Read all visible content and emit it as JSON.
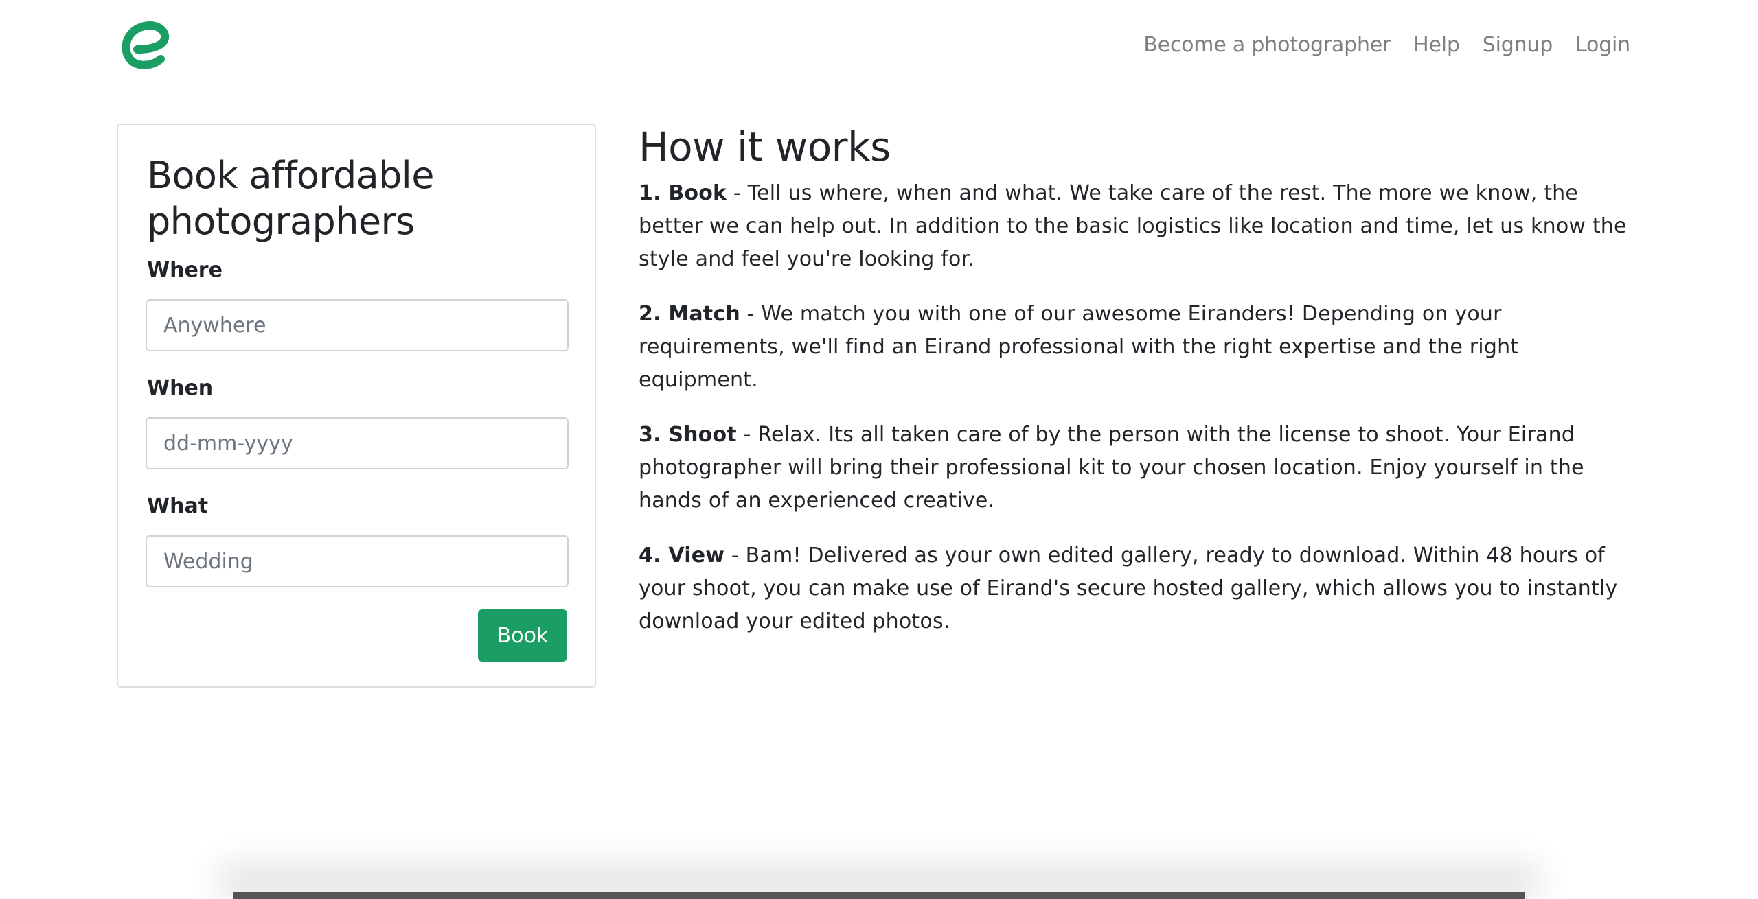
{
  "nav": {
    "logo_icon": "eirand-logo-icon",
    "brand_color": "#1a9e64",
    "links": {
      "become_photographer": "Become a photographer",
      "help": "Help",
      "signup": "Signup",
      "login": "Login"
    }
  },
  "booking": {
    "title": "Book affordable photographers",
    "where_label": "Where",
    "where_placeholder": "Anywhere",
    "when_label": "When",
    "when_placeholder": "dd-mm-yyyy",
    "what_label": "What",
    "what_placeholder": "Wedding",
    "book_label": "Book",
    "button_color": "#1a9e64"
  },
  "how_it_works": {
    "title": "How it works",
    "steps": [
      {
        "name": "1. Book",
        "text": " - Tell us where, when and what. We take care of the rest. The more we know, the better we can help out. In addition to the basic logistics like location and time, let us know the style and feel you're looking for."
      },
      {
        "name": "2. Match",
        "text": " - We match you with one of our awesome Eiranders! Depending on your requirements, we'll find an Eirand professional with the right expertise and the right equipment."
      },
      {
        "name": "3. Shoot",
        "text": " - Relax. Its all taken care of by the person with the license to shoot. Your Eirand photographer will bring their professional kit to your chosen location. Enjoy yourself in the hands of an experienced creative."
      },
      {
        "name": "4. View",
        "text": " - Bam! Delivered as your own edited gallery, ready to download. Within 48 hours of your shoot, you can make use of Eirand's secure hosted gallery, which allows you to instantly download your edited photos."
      }
    ]
  }
}
